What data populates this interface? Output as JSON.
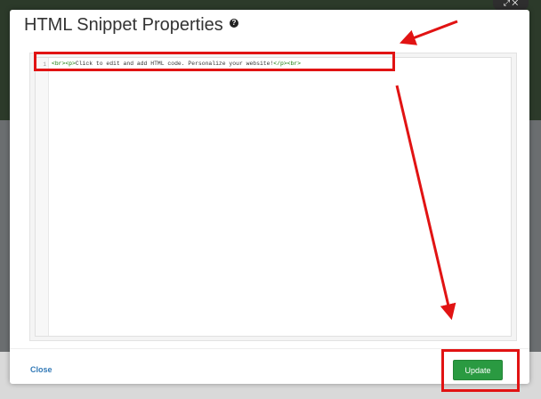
{
  "modal": {
    "title": "HTML Snippet Properties",
    "help_icon": "question-circle-icon"
  },
  "editor": {
    "line_number": "1",
    "code": [
      {
        "text": "<br><p>",
        "kind": "tag"
      },
      {
        "text": "Click to edit and add HTML code. Personalize your website!",
        "kind": "txt"
      },
      {
        "text": "</p><br>",
        "kind": "tag"
      }
    ]
  },
  "footer": {
    "close_label": "Close",
    "update_label": "Update"
  },
  "colors": {
    "accent_green": "#2a9a41",
    "link_blue": "#337ab7",
    "annotation_red": "#e11313",
    "code_tag_green": "#117700"
  },
  "corner_control": {
    "icon": "expand-close-icon"
  }
}
